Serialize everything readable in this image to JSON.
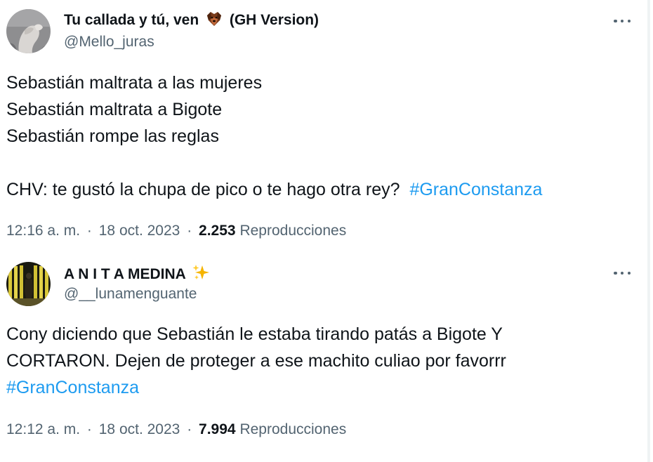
{
  "tweets": [
    {
      "display_name": "Tu callada y tú, ven",
      "name_emoji": "dog-face-emoji",
      "name_suffix": "(GH Version)",
      "handle": "@Mello_juras",
      "body": {
        "line1": "Sebastián maltrata a las mujeres",
        "line2": "Sebastián maltrata a Bigote",
        "line3": "Sebastián rompe las reglas",
        "line4": "CHV: te gustó la chupa de pico o te hago otra rey?",
        "hashtag": "#GranConstanza"
      },
      "time": "12:16 a. m.",
      "date": "18 oct. 2023",
      "separator": "·",
      "views_count": "2.253",
      "views_label": "Reproducciones"
    },
    {
      "display_name": "A N I T A MEDINA",
      "name_emoji": "sparkles-emoji",
      "handle": "@__lunamenguante",
      "body": {
        "line1": "Cony diciendo que Sebastián le estaba tirando patás a Bigote Y",
        "line2": "CORTARON. Dejen de proteger a ese machito culiao por favorrr",
        "hashtag": "#GranConstanza"
      },
      "time": "12:12 a. m.",
      "date": "18 oct. 2023",
      "separator": "·",
      "views_count": "7.994",
      "views_label": "Reproducciones"
    }
  ],
  "colors": {
    "text": "#0f1419",
    "secondary": "#536471",
    "link": "#1d9bf0",
    "sparkle": "#f5b400"
  },
  "icons": {
    "more": "more-horizontal-icon"
  }
}
